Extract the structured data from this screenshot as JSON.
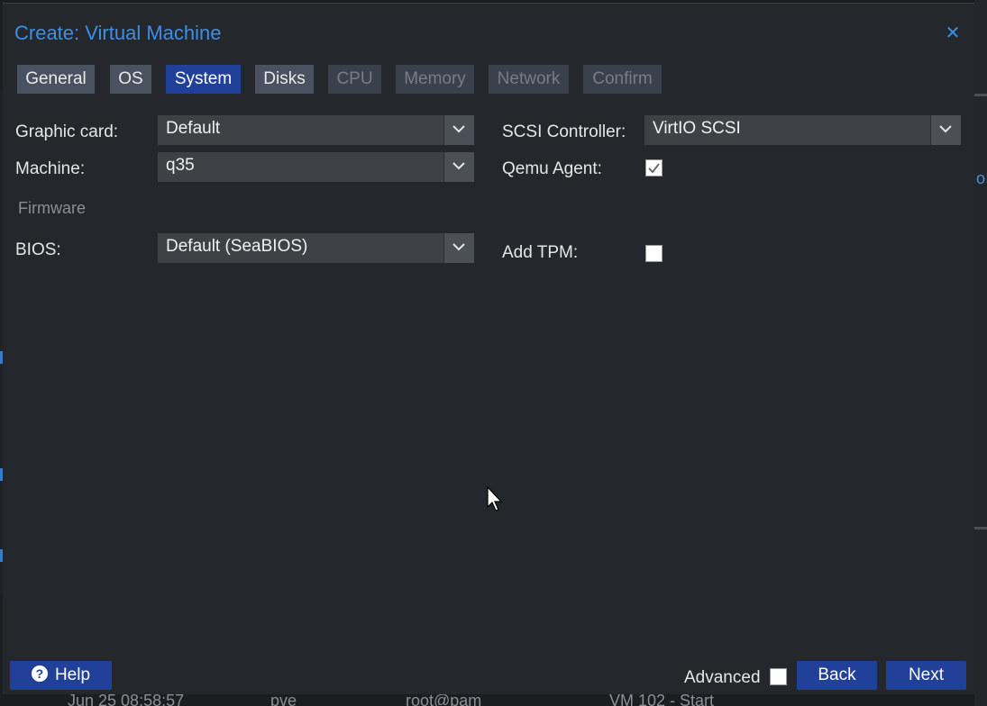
{
  "dialog": {
    "title": "Create: Virtual Machine",
    "close_icon": "close-icon"
  },
  "tabs": [
    {
      "label": "General",
      "state": "normal"
    },
    {
      "label": "OS",
      "state": "normal"
    },
    {
      "label": "System",
      "state": "active"
    },
    {
      "label": "Disks",
      "state": "normal"
    },
    {
      "label": "CPU",
      "state": "disabled"
    },
    {
      "label": "Memory",
      "state": "disabled"
    },
    {
      "label": "Network",
      "state": "disabled"
    },
    {
      "label": "Confirm",
      "state": "disabled"
    }
  ],
  "form": {
    "graphic_card": {
      "label": "Graphic card:",
      "value": "Default"
    },
    "machine": {
      "label": "Machine:",
      "value": "q35"
    },
    "firmware_section": "Firmware",
    "bios": {
      "label": "BIOS:",
      "value": "Default (SeaBIOS)"
    },
    "scsi_controller": {
      "label": "SCSI Controller:",
      "value": "VirtIO SCSI"
    },
    "qemu_agent": {
      "label": "Qemu Agent:",
      "checked": true
    },
    "add_tpm": {
      "label": "Add TPM:",
      "checked": false
    }
  },
  "footer": {
    "help_label": "Help",
    "advanced_label": "Advanced",
    "advanced_checked": false,
    "back_label": "Back",
    "next_label": "Next"
  },
  "background_task_row": [
    "Jun 25 08:58:57",
    "pve",
    "root@pam",
    "VM 102 - Start"
  ],
  "colors": {
    "accent": "#3d8ee6",
    "active_tab": "#21409a",
    "dialog_bg": "#24282c",
    "field_bg": "#3e4247"
  }
}
